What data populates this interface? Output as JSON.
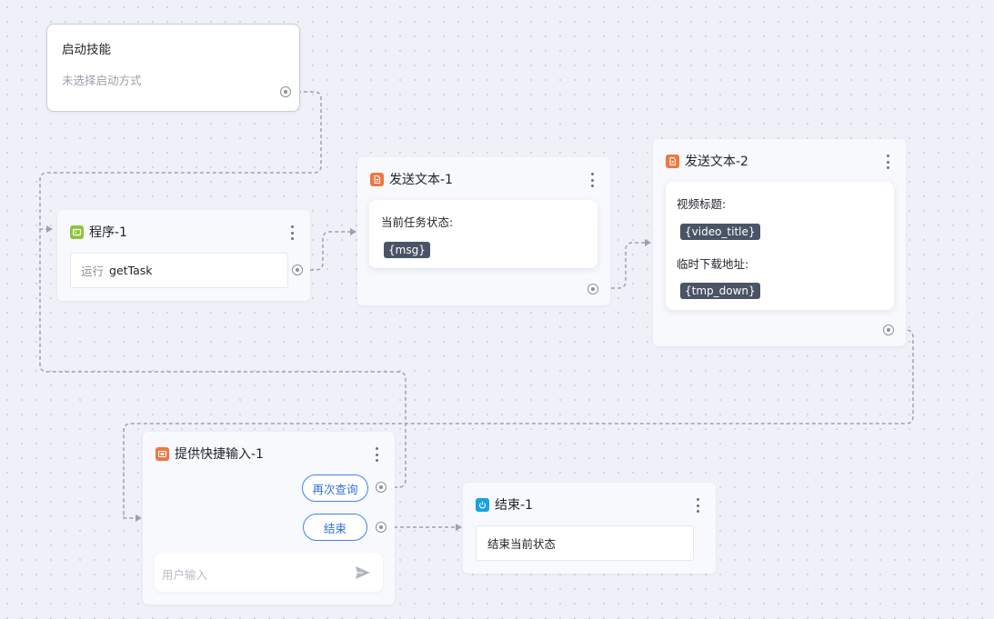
{
  "start": {
    "title": "启动技能",
    "subtitle": "未选择启动方式"
  },
  "program": {
    "title": "程序-1",
    "run_label": "运行",
    "task_name": "getTask",
    "icon": "code-icon",
    "icon_color": "#8cc63f"
  },
  "send1": {
    "title": "发送文本-1",
    "label": "当前任务状态:",
    "var": "{msg}",
    "icon": "document-icon",
    "icon_color": "#f07642"
  },
  "send2": {
    "title": "发送文本-2",
    "label1": "视频标题:",
    "var1": "{video_title}",
    "label2": "临时下载地址:",
    "var2": "{tmp_down}",
    "icon": "document-icon",
    "icon_color": "#f07642"
  },
  "quick": {
    "title": "提供快捷输入-1",
    "btn_requery": "再次查询",
    "btn_end": "结束",
    "input_placeholder": "用户输入",
    "icon": "input-icon",
    "icon_color": "#f07642"
  },
  "end": {
    "title": "结束-1",
    "body": "结束当前状态",
    "icon": "power-icon",
    "icon_color": "#1ba0e2"
  },
  "colors": {
    "accent": "#3b82f6",
    "edge": "#9ba1ad",
    "tag": "#4a5466"
  }
}
